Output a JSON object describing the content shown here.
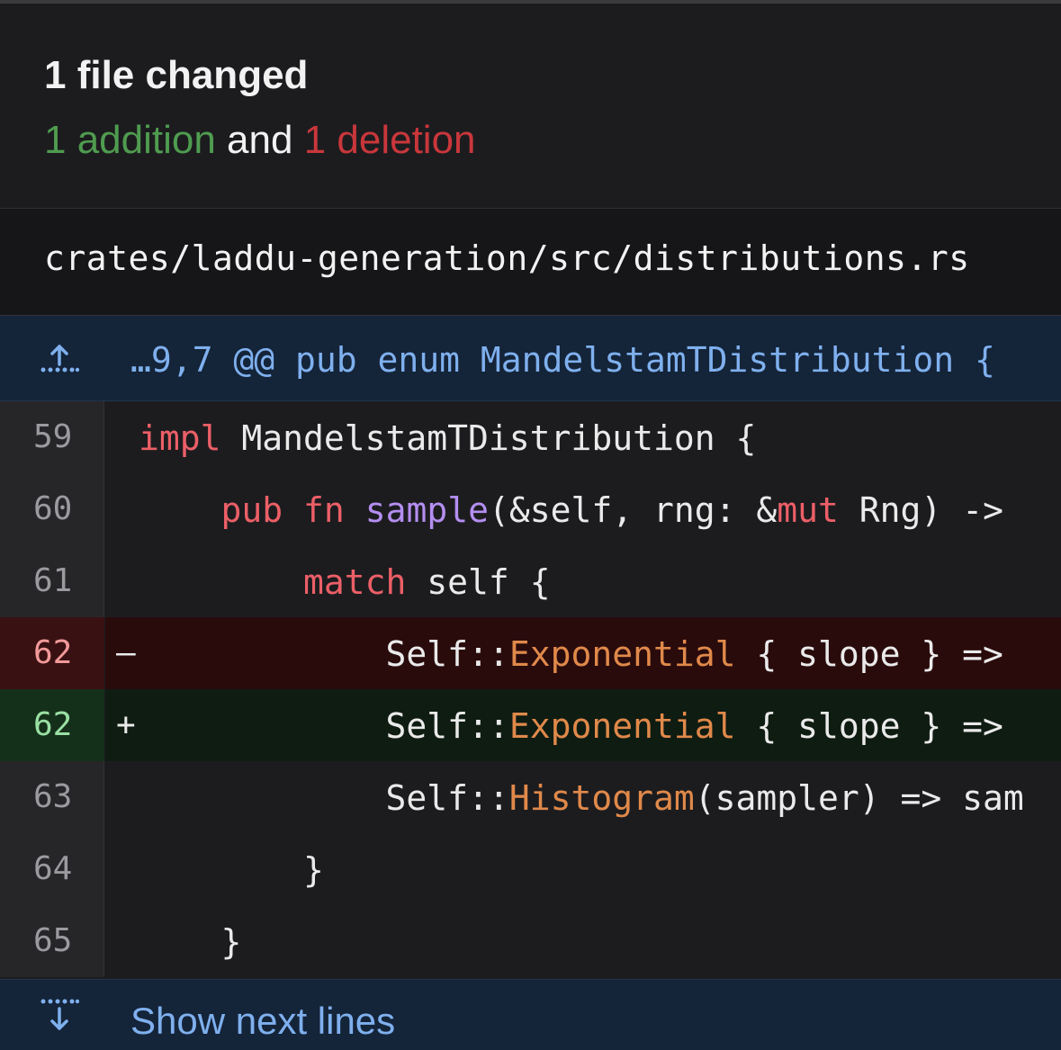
{
  "summary": {
    "title": "1 file changed",
    "additions": "1 addition",
    "and": " and ",
    "deletions": "1 deletion",
    "colors": {
      "addition": "#4f9c4f",
      "deletion": "#c9373b"
    }
  },
  "file": {
    "path": "crates/laddu-generation/src/distributions.rs"
  },
  "hunk": {
    "icon": "expand-up-icon",
    "header": "…9,7 @@ pub enum MandelstamTDistribution {"
  },
  "lines": [
    {
      "num": "59",
      "marker": "",
      "type": "context",
      "tokens": [
        {
          "t": "impl",
          "c": "kw"
        },
        {
          "t": " MandelstamTDistribution {",
          "c": ""
        }
      ]
    },
    {
      "num": "60",
      "marker": "",
      "type": "context",
      "tokens": [
        {
          "t": "    ",
          "c": ""
        },
        {
          "t": "pub",
          "c": "kw"
        },
        {
          "t": " ",
          "c": ""
        },
        {
          "t": "fn",
          "c": "kw"
        },
        {
          "t": " ",
          "c": ""
        },
        {
          "t": "sample",
          "c": "fn"
        },
        {
          "t": "(&self, rng: &",
          "c": ""
        },
        {
          "t": "mut",
          "c": "kw"
        },
        {
          "t": " Rng) ->",
          "c": ""
        }
      ]
    },
    {
      "num": "61",
      "marker": "",
      "type": "context",
      "tokens": [
        {
          "t": "        ",
          "c": ""
        },
        {
          "t": "match",
          "c": "kw"
        },
        {
          "t": " self {",
          "c": ""
        }
      ]
    },
    {
      "num": "62",
      "marker": "–",
      "type": "removed",
      "tokens": [
        {
          "t": "            Self::",
          "c": ""
        },
        {
          "t": "Exponential",
          "c": "ty"
        },
        {
          "t": " { slope } =>",
          "c": ""
        }
      ]
    },
    {
      "num": "62",
      "marker": "+",
      "type": "added",
      "tokens": [
        {
          "t": "            Self::",
          "c": ""
        },
        {
          "t": "Exponential",
          "c": "ty"
        },
        {
          "t": " { slope } =>",
          "c": ""
        }
      ]
    },
    {
      "num": "63",
      "marker": "",
      "type": "context",
      "tokens": [
        {
          "t": "            Self::",
          "c": ""
        },
        {
          "t": "Histogram",
          "c": "ty"
        },
        {
          "t": "(sampler) => sam",
          "c": ""
        }
      ]
    },
    {
      "num": "64",
      "marker": "",
      "type": "context",
      "tokens": [
        {
          "t": "        }",
          "c": ""
        }
      ]
    },
    {
      "num": "65",
      "marker": "",
      "type": "context",
      "tokens": [
        {
          "t": "    }",
          "c": ""
        }
      ]
    }
  ],
  "footer": {
    "icon": "expand-down-icon",
    "label": "Show next lines"
  }
}
